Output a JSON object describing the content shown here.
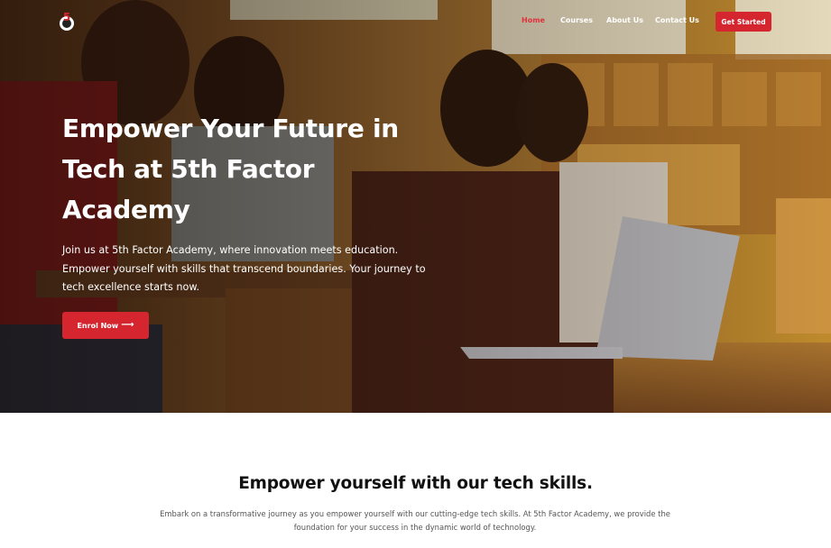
{
  "nav": {
    "logo_text": "5",
    "links": [
      {
        "label": "Home",
        "active": true
      },
      {
        "label": "Courses",
        "active": false
      },
      {
        "label": "About Us",
        "active": false
      },
      {
        "label": "Contact Us",
        "active": false
      }
    ],
    "cta_label": "Get Started"
  },
  "hero": {
    "title": "Empower Your Future in Tech at 5th Factor Academy",
    "description": "Join us at 5th Factor Academy, where innovation meets education. Empower yourself with skills that transcend boundaries. Your journey to tech excellence starts now.",
    "enrol_label": "Enrol Now",
    "enrol_icon": "arrow-right-icon"
  },
  "skills": {
    "title": "Empower yourself with our tech skills.",
    "description": "Embark on a transformative journey as you empower yourself with our cutting-edge tech skills. At 5th Factor Academy, we provide the foundation for your success in the dynamic world of technology."
  },
  "colors": {
    "accent": "#d5252f",
    "active_link": "#e0313c",
    "text_white": "#ffffff"
  }
}
